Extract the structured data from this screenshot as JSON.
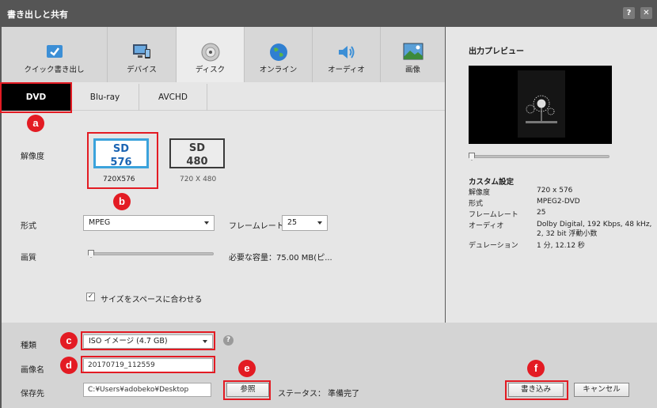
{
  "window": {
    "title": "書き出しと共有",
    "help_button": "?",
    "close_button": "✕"
  },
  "tabs": [
    {
      "label": "クイック書き出し",
      "icon": "quick-export-icon"
    },
    {
      "label": "デバイス",
      "icon": "device-icon"
    },
    {
      "label": "ディスク",
      "icon": "disc-icon",
      "active": true
    },
    {
      "label": "オンライン",
      "icon": "globe-icon"
    },
    {
      "label": "オーディオ",
      "icon": "speaker-icon"
    },
    {
      "label": "画像",
      "icon": "image-icon"
    }
  ],
  "subtabs": [
    {
      "label": "DVD",
      "active": true
    },
    {
      "label": "Blu-ray"
    },
    {
      "label": "AVCHD"
    }
  ],
  "resolution": {
    "label": "解像度",
    "options": [
      {
        "line1": "SD",
        "line2": "576",
        "caption": "720X576",
        "selected": true
      },
      {
        "line1": "SD",
        "line2": "480",
        "caption": "720 X 480",
        "selected": false
      }
    ]
  },
  "format": {
    "label": "形式",
    "value": "MPEG"
  },
  "framerate": {
    "label": "フレームレート",
    "value": "25"
  },
  "quality": {
    "label": "画質",
    "required_space": "必要な容量：75.00 MB(ピ..."
  },
  "fit_to_space": {
    "label": "サイズをスペースに合わせる",
    "checked": true
  },
  "preview": {
    "title": "出力プレビュー",
    "custom_settings_title": "カスタム設定",
    "settings": [
      {
        "key": "解像度",
        "value": "720 x 576"
      },
      {
        "key": "形式",
        "value": "MPEG2-DVD"
      },
      {
        "key": "フレームレート",
        "value": "25"
      },
      {
        "key": "オーディオ",
        "value": "Dolby Digital, 192 Kbps, 48 kHz, 2, 32 bit 浮動小数"
      },
      {
        "key": "デュレーション",
        "value": "1 分, 12.12 秒"
      }
    ]
  },
  "bottom": {
    "type_label": "種類",
    "type_value": "ISO イメージ (4.7 GB)",
    "name_label": "画像名",
    "name_value": "20170719_112559",
    "save_label": "保存先",
    "save_value": "C:¥Users¥adobeko¥Desktop",
    "browse_button": "参照",
    "status": "ステータス： 準備完了",
    "write_button": "書き込み",
    "cancel_button": "キャンセル",
    "help": "?"
  },
  "annotations": [
    "a",
    "b",
    "c",
    "d",
    "e",
    "f"
  ],
  "colors": {
    "annotation_red": "#e31b23",
    "selected_blue": "#3ba3dc"
  }
}
